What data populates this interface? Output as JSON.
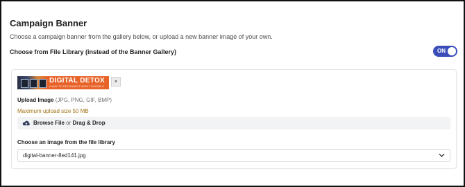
{
  "campaign_banner": {
    "title": "Campaign Banner",
    "description": "Choose a campaign banner from the gallery below, or upload a new banner image of your own.",
    "toggle": {
      "label": "Choose from File Library (instead of the Banner Gallery)",
      "state_text": "ON",
      "is_on": true,
      "color": "#3b4db8"
    }
  },
  "uploader": {
    "preview": {
      "headline": "DIGITAL DETOX",
      "subline": "A WAY TO RECONNECT WITH YOURSELF",
      "background_color": "#e8632a"
    },
    "remove_label": "×",
    "upload_label": "Upload Image",
    "upload_types": "(JPG, PNG, GIF, BMP)",
    "max_size": "Maximum upload size 50 MB",
    "browse_label": "Browse File",
    "or_label": "or",
    "drag_label": "Drag & Drop",
    "browse_icon": "cloud-upload-icon"
  },
  "file_library": {
    "label": "Choose an image from the file library",
    "selected": "digital-banner-8ed141.jpg"
  }
}
